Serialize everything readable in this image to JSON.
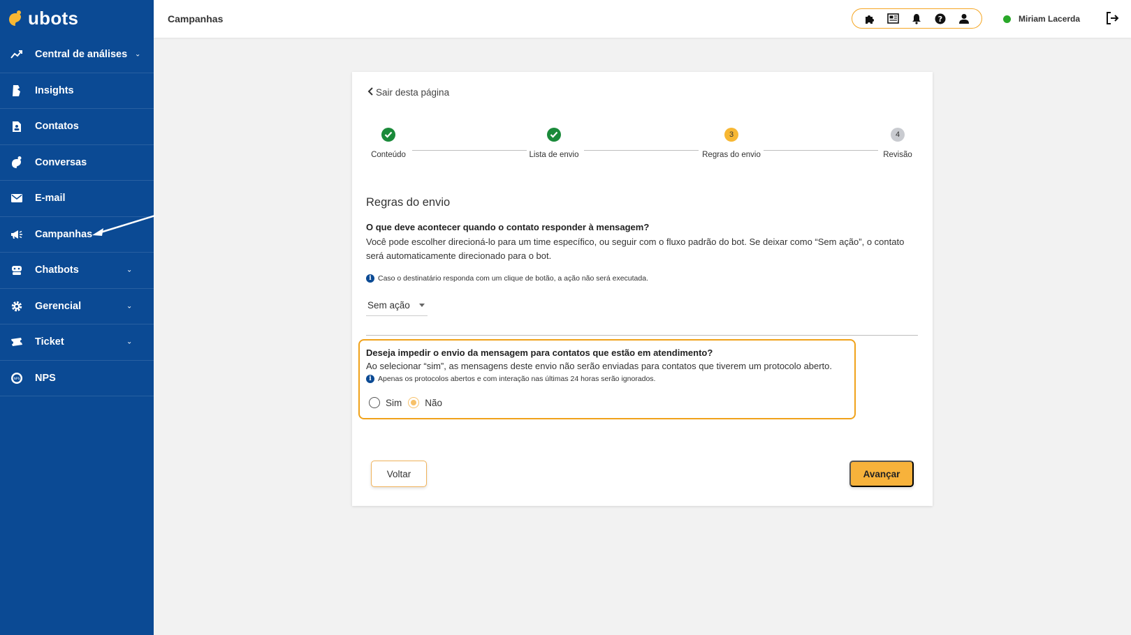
{
  "app": {
    "logo_text": "ubots"
  },
  "sidebar": {
    "items": [
      {
        "label": "Central de análises",
        "icon": "analytics-icon",
        "has_chevron": true
      },
      {
        "label": "Insights",
        "icon": "insights-icon",
        "has_chevron": false
      },
      {
        "label": "Contatos",
        "icon": "contacts-icon",
        "has_chevron": false
      },
      {
        "label": "Conversas",
        "icon": "conversations-icon",
        "has_chevron": false
      },
      {
        "label": "E-mail",
        "icon": "email-icon",
        "has_chevron": false
      },
      {
        "label": "Campanhas",
        "icon": "megaphone-icon",
        "has_chevron": false
      },
      {
        "label": "Chatbots",
        "icon": "robot-icon",
        "has_chevron": true
      },
      {
        "label": "Gerencial",
        "icon": "gear-icon",
        "has_chevron": true
      },
      {
        "label": "Ticket",
        "icon": "ticket-icon",
        "has_chevron": true
      },
      {
        "label": "NPS",
        "icon": "nps-icon",
        "has_chevron": false
      }
    ]
  },
  "header": {
    "title": "Campanhas",
    "tools": [
      "puzzle-icon",
      "news-icon",
      "bell-icon",
      "help-icon",
      "user-icon"
    ],
    "user_name": "Miriam Lacerda",
    "status_color": "#29a829"
  },
  "wizard": {
    "back_link": "Sair desta página",
    "steps": [
      {
        "label": "Conteúdo",
        "state": "done",
        "number": ""
      },
      {
        "label": "Lista de envio",
        "state": "done",
        "number": ""
      },
      {
        "label": "Regras do envio",
        "state": "active",
        "number": "3"
      },
      {
        "label": "Revisão",
        "state": "todo",
        "number": "4"
      }
    ],
    "section_title": "Regras do envio",
    "question": "O que deve acontecer quando o contato responder à mensagem?",
    "description": "Você pode escolher direcioná-lo para um time específico, ou seguir com o fluxo padrão do bot. Se deixar como “Sem ação”, o contato será automaticamente direcionado para o bot.",
    "info_note": "Caso o destinatário responda com um clique de botão, a ação não será executada.",
    "select_value": "Sem ação",
    "question2": "Deseja impedir o envio da mensagem para contatos que estão em atendimento?",
    "description2": "Ao selecionar “sim”, as mensagens deste envio não serão enviadas para contatos que tiverem um protocolo aberto.",
    "info_note2": "Apenas os protocolos abertos e com interação nas últimas 24 horas serão ignorados.",
    "radio_yes": "Sim",
    "radio_no": "Não",
    "selected_radio": "Não",
    "btn_back": "Voltar",
    "btn_next": "Avançar"
  },
  "colors": {
    "sidebar_bg": "#0b4a94",
    "accent": "#f7b23b",
    "highlight_border": "#f0a21a",
    "step_done": "#1a8a3a"
  }
}
